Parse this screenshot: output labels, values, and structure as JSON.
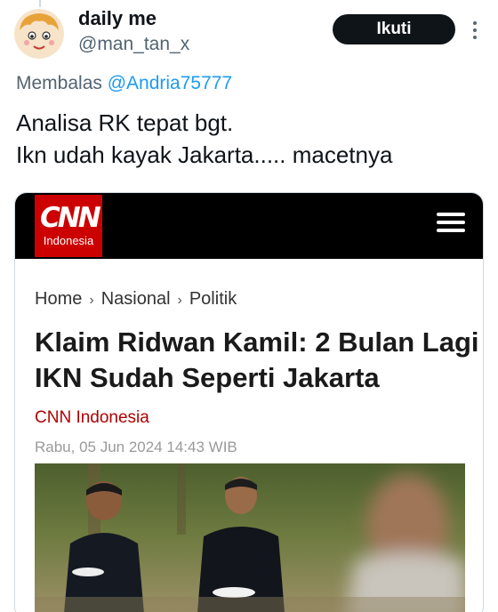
{
  "tweet": {
    "display_name": "daily me",
    "handle": "@man_tan_x",
    "follow_label": "Ikuti",
    "reply_prefix": "Membalas",
    "reply_mention": "@Andria75777",
    "text_line1": "Analisa RK tepat bgt.",
    "text_line2": "Ikn udah kayak Jakarta..... macetnya"
  },
  "card": {
    "logo_text": "CNN",
    "logo_subtext": "Indonesia",
    "breadcrumb": [
      "Home",
      "Nasional",
      "Politik"
    ],
    "breadcrumb_separator": "›",
    "headline": "Klaim Ridwan Kamil: 2 Bulan Lagi IKN Sudah Seperti Jakarta",
    "source": "CNN Indonesia",
    "dateline": "Rabu, 05 Jun 2024 14:43 WIB"
  },
  "icons": {
    "more": "more-vertical-icon",
    "menu": "hamburger-menu-icon"
  },
  "colors": {
    "follow_bg": "#0f1419",
    "mention": "#1d9bf0",
    "cnn_red": "#cc0000",
    "source_red": "#b00000"
  }
}
